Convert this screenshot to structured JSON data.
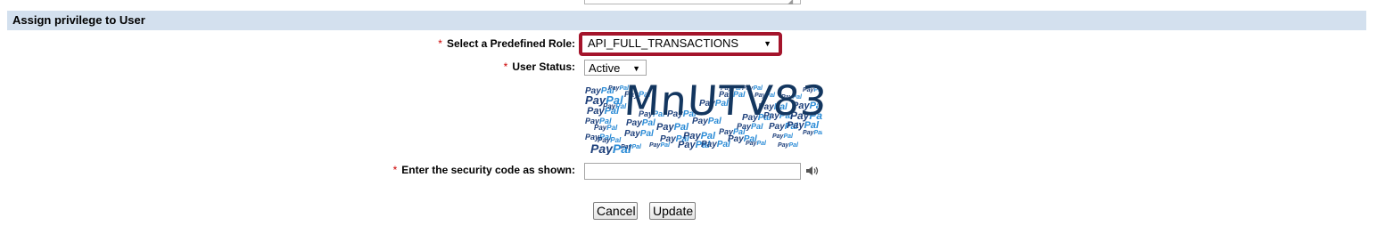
{
  "section": {
    "title": "Assign privilege to User"
  },
  "form": {
    "role": {
      "label": "Select a Predefined Role:",
      "value": "API_FULL_TRANSACTIONS",
      "highlight_color": "#a4142b"
    },
    "status": {
      "label": "User Status:",
      "value": "Active"
    },
    "security": {
      "label": "Enter the security code as shown:",
      "captcha_text": "MnUTV83",
      "value": ""
    },
    "required_marker": "*"
  },
  "captcha_tiles": {
    "brand_a": "Pay",
    "brand_b": "Pal"
  },
  "actions": {
    "cancel_label": "Cancel",
    "update_label": "Update"
  },
  "colors": {
    "header_bg": "#d3e0ee",
    "required": "#cc0000"
  }
}
